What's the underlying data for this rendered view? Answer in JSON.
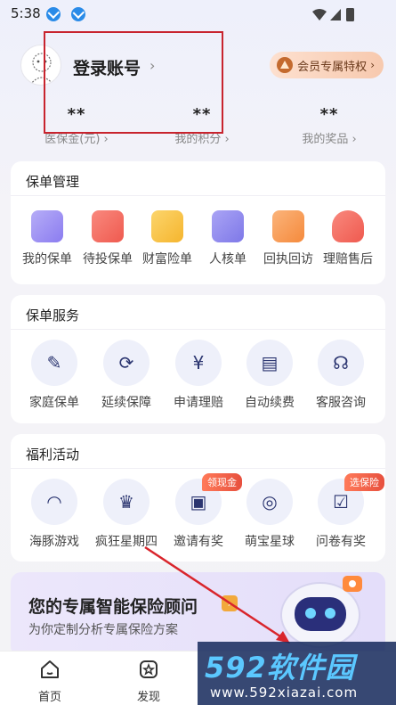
{
  "status_bar": {
    "time": "5:38"
  },
  "profile": {
    "login_label": "登录账号",
    "login_arrow": "›",
    "vip_label": "会员专属特权",
    "vip_arrow": "›",
    "stats": [
      {
        "value": "**",
        "label": "医保金(元) ›"
      },
      {
        "value": "**",
        "label": "我的积分 ›"
      },
      {
        "value": "**",
        "label": "我的奖品 ›"
      }
    ]
  },
  "policy_management": {
    "title": "保单管理",
    "items": [
      {
        "label": "我的保单",
        "icon": "policy-doc-icon",
        "color": "#8b7cf0"
      },
      {
        "label": "待投保单",
        "icon": "pending-policy-icon",
        "color": "#ef5a4f"
      },
      {
        "label": "财富险单",
        "icon": "wealth-wallet-icon",
        "color": "#f5b52e"
      },
      {
        "label": "人核单",
        "icon": "review-folder-icon",
        "color": "#7e78e8"
      },
      {
        "label": "回执回访",
        "icon": "receipt-icon",
        "color": "#f58a3c"
      },
      {
        "label": "理赔售后",
        "icon": "claim-bag-icon",
        "color": "#ef5a4f"
      }
    ]
  },
  "policy_service": {
    "title": "保单服务",
    "items": [
      {
        "label": "家庭保单",
        "icon": "family-policy-icon",
        "glyph": "✎"
      },
      {
        "label": "延续保障",
        "icon": "renew-shield-icon",
        "glyph": "⟳"
      },
      {
        "label": "申请理赔",
        "icon": "claim-yen-icon",
        "glyph": "¥"
      },
      {
        "label": "自动续费",
        "icon": "auto-renew-icon",
        "glyph": "▤"
      },
      {
        "label": "客服咨询",
        "icon": "headset-icon",
        "glyph": "☊"
      }
    ]
  },
  "welfare": {
    "title": "福利活动",
    "items": [
      {
        "label": "海豚游戏",
        "icon": "dolphin-icon",
        "glyph": "◠",
        "badge": ""
      },
      {
        "label": "疯狂星期四",
        "icon": "crown-icon",
        "glyph": "♛",
        "badge": ""
      },
      {
        "label": "邀请有奖",
        "icon": "invite-gift-icon",
        "glyph": "▣",
        "badge": "领现金"
      },
      {
        "label": "萌宝星球",
        "icon": "planet-icon",
        "glyph": "◎",
        "badge": ""
      },
      {
        "label": "问卷有奖",
        "icon": "questionnaire-icon",
        "glyph": "☑",
        "badge": "选保险"
      }
    ]
  },
  "promo": {
    "title": "您的专属智能保险顾问",
    "arrow": "›",
    "subtitle": "为你定制分析专属保险方案"
  },
  "tab_bar": {
    "tabs": [
      {
        "label": "首页",
        "icon": "home-icon"
      },
      {
        "label": "发现",
        "icon": "discover-icon"
      }
    ]
  },
  "watermark": {
    "main": "592软件园",
    "url": "www.592xiazai.com"
  }
}
